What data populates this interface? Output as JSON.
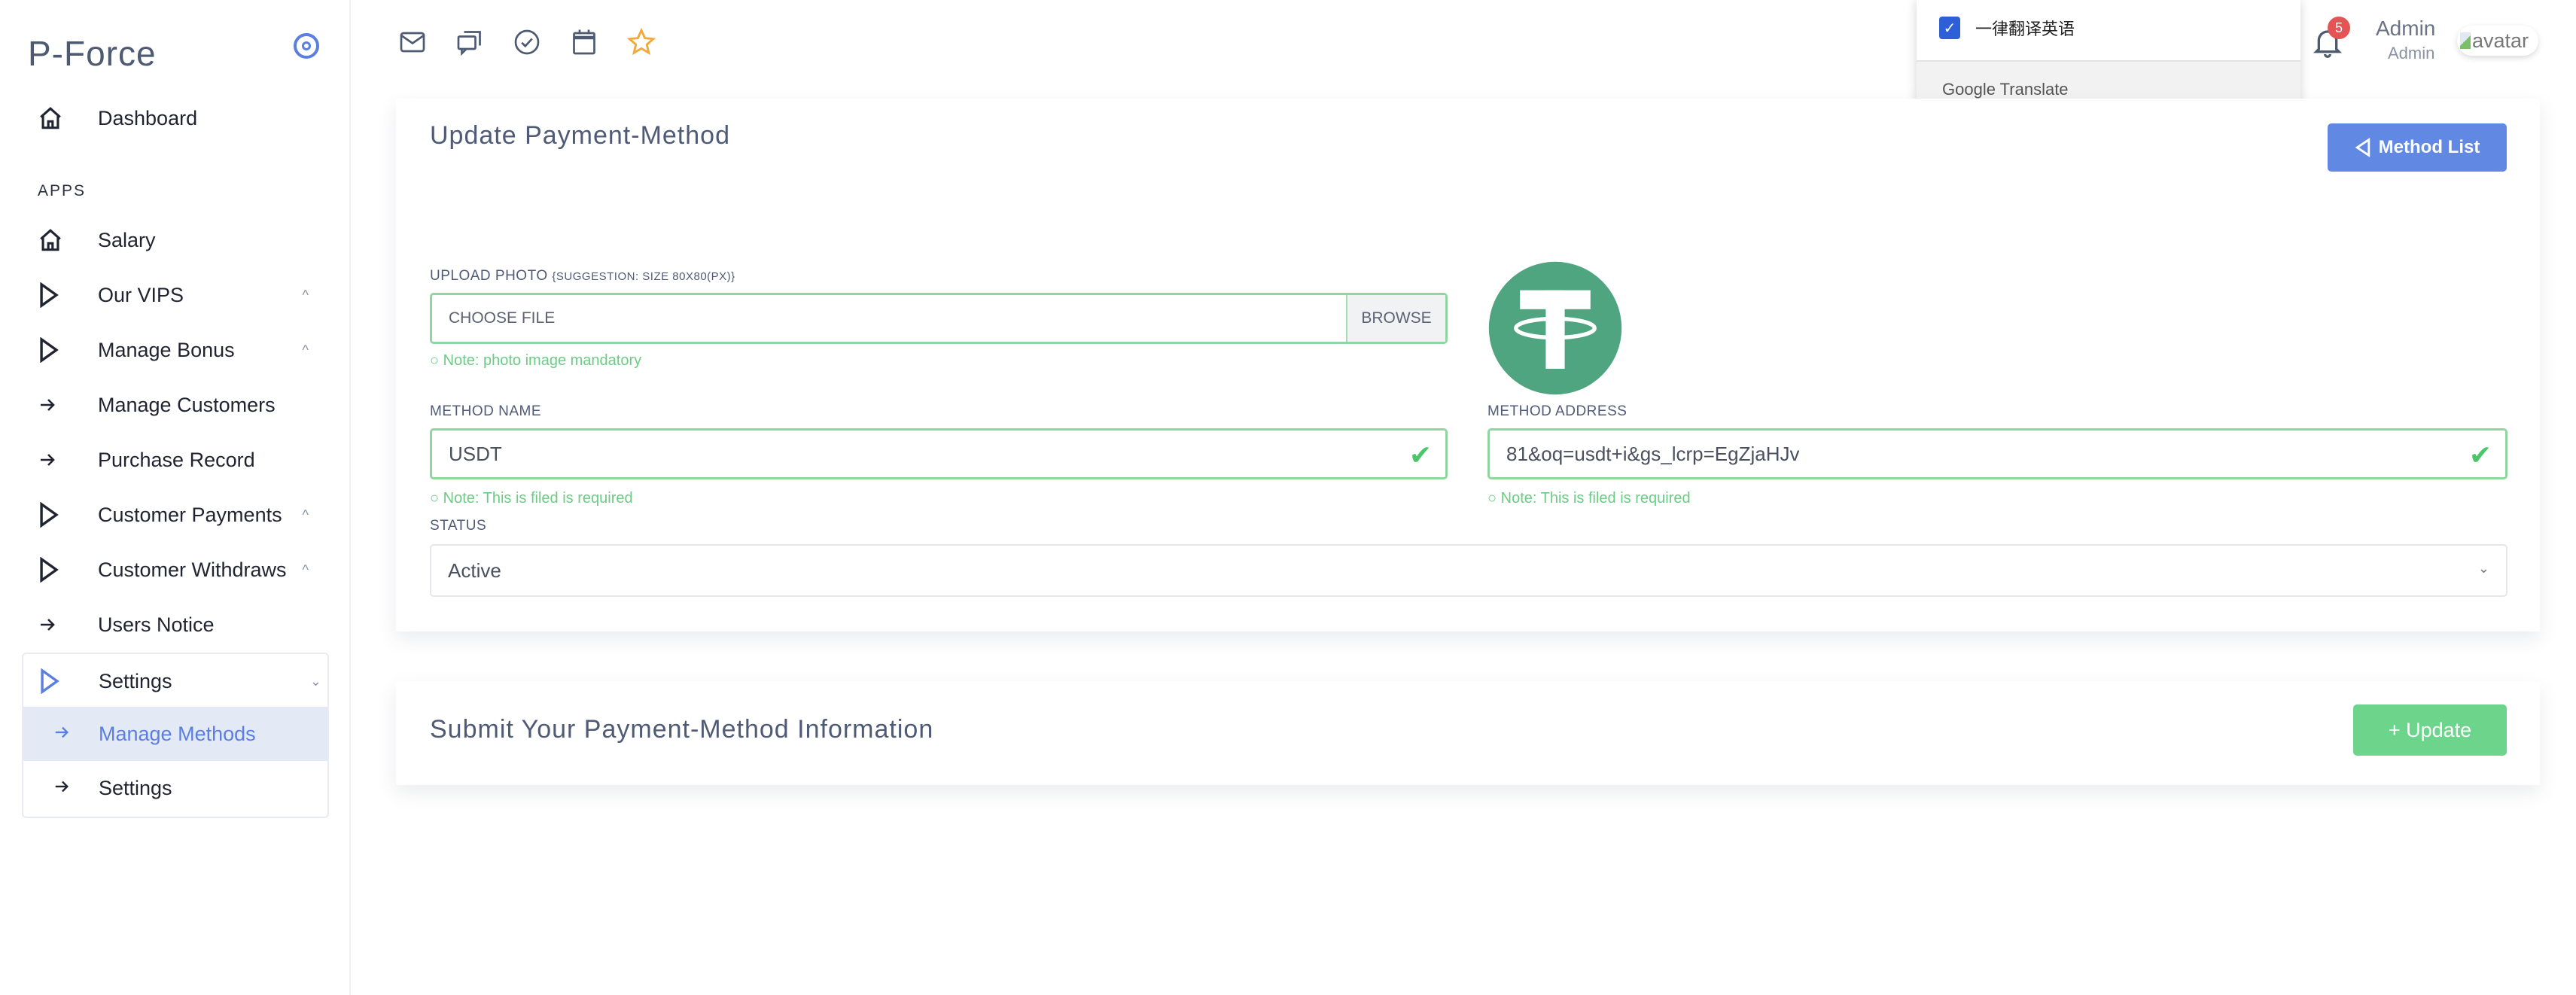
{
  "sidebar": {
    "brand": "P-Force",
    "toggle_icon": "target-circle-icon",
    "dashboard": "Dashboard",
    "section_label": "APPS",
    "items": [
      {
        "label": "Salary",
        "icon": "home-icon",
        "chevron": ""
      },
      {
        "label": "Our VIPS",
        "icon": "play-triangle-icon",
        "chevron": "^"
      },
      {
        "label": "Manage Bonus",
        "icon": "play-triangle-icon",
        "chevron": "^"
      },
      {
        "label": "Manage Customers",
        "icon": "arrow-right-icon",
        "chevron": ""
      },
      {
        "label": "Purchase Record",
        "icon": "arrow-right-icon",
        "chevron": ""
      },
      {
        "label": "Customer Payments",
        "icon": "play-triangle-icon",
        "chevron": "^"
      },
      {
        "label": "Customer Withdraws",
        "icon": "play-triangle-icon",
        "chevron": "^"
      },
      {
        "label": "Users Notice",
        "icon": "arrow-right-icon",
        "chevron": ""
      }
    ],
    "settings_group": {
      "label": "Settings",
      "chevron": "v",
      "children": [
        {
          "label": "Manage Methods",
          "active": true
        },
        {
          "label": "Settings",
          "active": false
        }
      ]
    }
  },
  "topbar": {
    "icons": [
      "mail-icon",
      "chat-icon",
      "check-circle-icon",
      "calendar-icon",
      "star-icon"
    ],
    "translate_popup": {
      "checkbox_label": "一律翻译英语",
      "checked": true,
      "footer": "Google Translate"
    },
    "notifications_count": "5",
    "user_name": "Admin",
    "user_role": "Admin",
    "avatar_alt": "avatar"
  },
  "form_card": {
    "title": "Update Payment-Method",
    "method_list_button": "Method List",
    "upload_label": "UPLOAD PHOTO",
    "upload_suggestion": "{SUGGESTION: SIZE 80X80(PX)}",
    "file_placeholder": "CHOOSE FILE",
    "browse_label": "BROWSE",
    "upload_note": "Note: photo image mandatory",
    "method_name_label": "METHOD NAME",
    "method_name_value": "USDT",
    "method_name_note": "Note: This is filed is required",
    "method_address_label": "METHOD ADDRESS",
    "method_address_value": "81&oq=usdt+i&gs_lcrp=EgZjaHJv",
    "method_address_note": "Note: This is filed is required",
    "status_label": "STATUS",
    "status_value": "Active"
  },
  "submit_card": {
    "title": "Submit Your Payment-Method Information",
    "update_button": "+ Update"
  },
  "colors": {
    "primary": "#6189e3",
    "success": "#6dd48b",
    "valid_border": "#8fd6a0",
    "badge": "#e55454",
    "usdt_green": "#4fa57f"
  }
}
